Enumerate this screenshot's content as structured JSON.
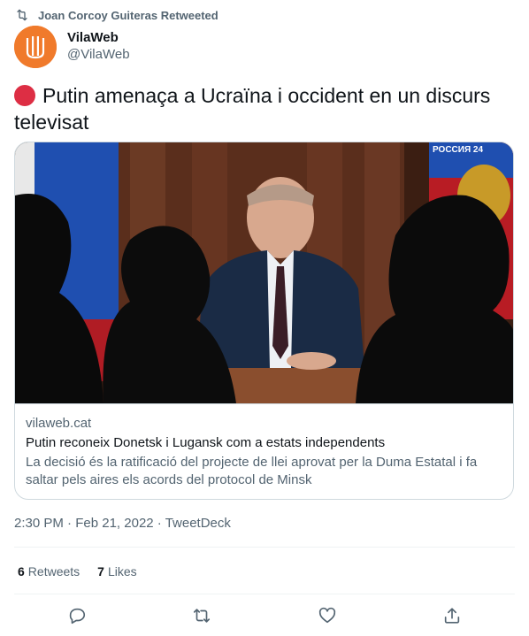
{
  "retweet_context": {
    "text": "Joan Corcoy Guiteras Retweeted",
    "icon": "retweet-icon"
  },
  "author": {
    "name": "VilaWeb",
    "handle": "@VilaWeb",
    "avatar_color": "#f07a2b"
  },
  "tweet": {
    "emoji": "red-circle",
    "emoji_color": "#dd2e44",
    "text": "Putin amenaça a Ucraïna i occident en un discurs televisat"
  },
  "card": {
    "domain": "vilaweb.cat",
    "title": "Putin reconeix Donetsk i Lugansk com a estats independents",
    "description": "La decisió és la ratificació del projecte de llei aprovat per la Duma Estatal i fa saltar pels aires els acords del protocol de Minsk",
    "image_badge": "РОССИЯ 24"
  },
  "meta": {
    "time": "2:30 PM",
    "separator": "·",
    "date": "Feb 21, 2022",
    "source": "TweetDeck"
  },
  "stats": {
    "retweets_count": "6",
    "retweets_label": "Retweets",
    "likes_count": "7",
    "likes_label": "Likes"
  },
  "actions": [
    "reply-icon",
    "retweet-icon",
    "like-icon",
    "share-icon"
  ],
  "colors": {
    "text": "#0f1419",
    "secondary": "#536471",
    "border": "#cfd9de"
  }
}
